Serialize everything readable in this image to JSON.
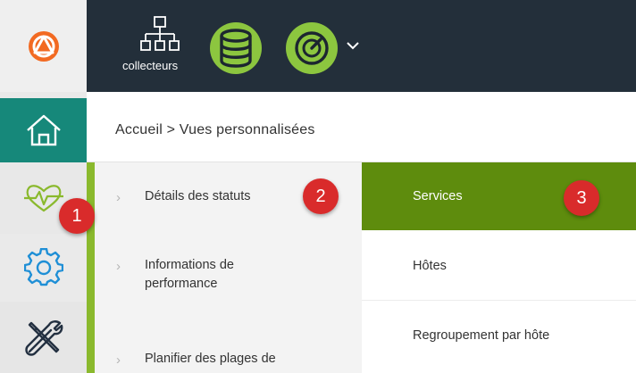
{
  "header": {
    "collectors_label": "collecteurs",
    "colors": {
      "background": "#232f3a",
      "database_icon": "#8cc63f",
      "status_icon": "#8cc63f"
    }
  },
  "rail": {
    "items": [
      {
        "icon": "logo-icon"
      },
      {
        "icon": "home-icon",
        "active": true
      },
      {
        "icon": "heartbeat-icon"
      },
      {
        "icon": "gear-icon"
      },
      {
        "icon": "tools-icon"
      }
    ],
    "colors": {
      "active": "#16887a",
      "logo": "#f26a22"
    }
  },
  "breadcrumb": {
    "text": "Accueil > Vues personnalisées"
  },
  "submenu": {
    "items": [
      {
        "label": "Détails des statuts"
      },
      {
        "label": "Informations de performance"
      },
      {
        "label": "Planifier des plages de"
      }
    ],
    "accent_color": "#8ab92d"
  },
  "subsubmenu": {
    "items": [
      {
        "label": "Services",
        "selected": true
      },
      {
        "label": "Hôtes"
      },
      {
        "label": "Regroupement par hôte"
      }
    ],
    "selected_color": "#5e8c0d"
  },
  "annotations": [
    {
      "label": "1"
    },
    {
      "label": "2"
    },
    {
      "label": "3"
    }
  ]
}
